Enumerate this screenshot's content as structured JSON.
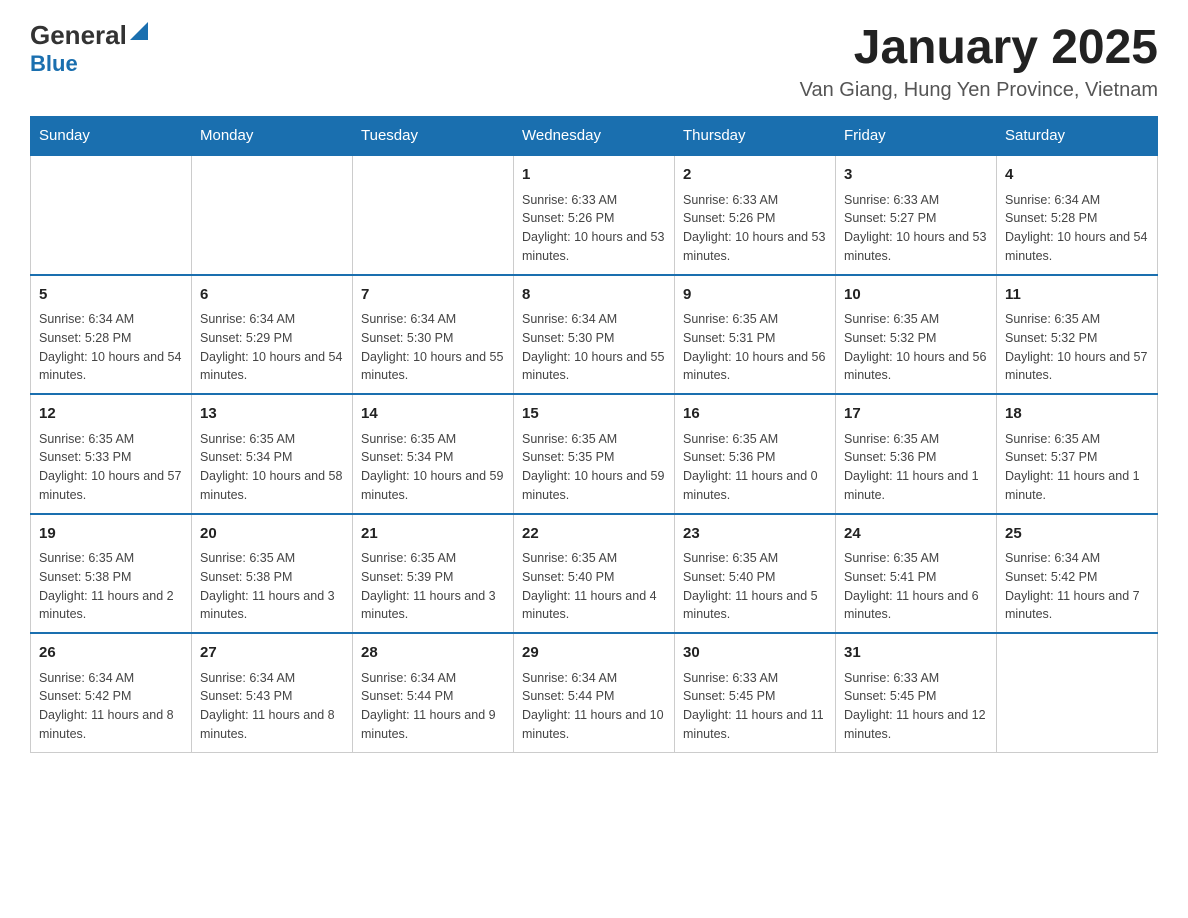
{
  "header": {
    "logo_general": "General",
    "logo_blue": "Blue",
    "title": "January 2025",
    "subtitle": "Van Giang, Hung Yen Province, Vietnam"
  },
  "days_of_week": [
    "Sunday",
    "Monday",
    "Tuesday",
    "Wednesday",
    "Thursday",
    "Friday",
    "Saturday"
  ],
  "weeks": [
    {
      "cells": [
        {
          "day": null
        },
        {
          "day": null
        },
        {
          "day": null
        },
        {
          "day": "1",
          "info": "Sunrise: 6:33 AM\nSunset: 5:26 PM\nDaylight: 10 hours and 53 minutes."
        },
        {
          "day": "2",
          "info": "Sunrise: 6:33 AM\nSunset: 5:26 PM\nDaylight: 10 hours and 53 minutes."
        },
        {
          "day": "3",
          "info": "Sunrise: 6:33 AM\nSunset: 5:27 PM\nDaylight: 10 hours and 53 minutes."
        },
        {
          "day": "4",
          "info": "Sunrise: 6:34 AM\nSunset: 5:28 PM\nDaylight: 10 hours and 54 minutes."
        }
      ]
    },
    {
      "cells": [
        {
          "day": "5",
          "info": "Sunrise: 6:34 AM\nSunset: 5:28 PM\nDaylight: 10 hours and 54 minutes."
        },
        {
          "day": "6",
          "info": "Sunrise: 6:34 AM\nSunset: 5:29 PM\nDaylight: 10 hours and 54 minutes."
        },
        {
          "day": "7",
          "info": "Sunrise: 6:34 AM\nSunset: 5:30 PM\nDaylight: 10 hours and 55 minutes."
        },
        {
          "day": "8",
          "info": "Sunrise: 6:34 AM\nSunset: 5:30 PM\nDaylight: 10 hours and 55 minutes."
        },
        {
          "day": "9",
          "info": "Sunrise: 6:35 AM\nSunset: 5:31 PM\nDaylight: 10 hours and 56 minutes."
        },
        {
          "day": "10",
          "info": "Sunrise: 6:35 AM\nSunset: 5:32 PM\nDaylight: 10 hours and 56 minutes."
        },
        {
          "day": "11",
          "info": "Sunrise: 6:35 AM\nSunset: 5:32 PM\nDaylight: 10 hours and 57 minutes."
        }
      ]
    },
    {
      "cells": [
        {
          "day": "12",
          "info": "Sunrise: 6:35 AM\nSunset: 5:33 PM\nDaylight: 10 hours and 57 minutes."
        },
        {
          "day": "13",
          "info": "Sunrise: 6:35 AM\nSunset: 5:34 PM\nDaylight: 10 hours and 58 minutes."
        },
        {
          "day": "14",
          "info": "Sunrise: 6:35 AM\nSunset: 5:34 PM\nDaylight: 10 hours and 59 minutes."
        },
        {
          "day": "15",
          "info": "Sunrise: 6:35 AM\nSunset: 5:35 PM\nDaylight: 10 hours and 59 minutes."
        },
        {
          "day": "16",
          "info": "Sunrise: 6:35 AM\nSunset: 5:36 PM\nDaylight: 11 hours and 0 minutes."
        },
        {
          "day": "17",
          "info": "Sunrise: 6:35 AM\nSunset: 5:36 PM\nDaylight: 11 hours and 1 minute."
        },
        {
          "day": "18",
          "info": "Sunrise: 6:35 AM\nSunset: 5:37 PM\nDaylight: 11 hours and 1 minute."
        }
      ]
    },
    {
      "cells": [
        {
          "day": "19",
          "info": "Sunrise: 6:35 AM\nSunset: 5:38 PM\nDaylight: 11 hours and 2 minutes."
        },
        {
          "day": "20",
          "info": "Sunrise: 6:35 AM\nSunset: 5:38 PM\nDaylight: 11 hours and 3 minutes."
        },
        {
          "day": "21",
          "info": "Sunrise: 6:35 AM\nSunset: 5:39 PM\nDaylight: 11 hours and 3 minutes."
        },
        {
          "day": "22",
          "info": "Sunrise: 6:35 AM\nSunset: 5:40 PM\nDaylight: 11 hours and 4 minutes."
        },
        {
          "day": "23",
          "info": "Sunrise: 6:35 AM\nSunset: 5:40 PM\nDaylight: 11 hours and 5 minutes."
        },
        {
          "day": "24",
          "info": "Sunrise: 6:35 AM\nSunset: 5:41 PM\nDaylight: 11 hours and 6 minutes."
        },
        {
          "day": "25",
          "info": "Sunrise: 6:34 AM\nSunset: 5:42 PM\nDaylight: 11 hours and 7 minutes."
        }
      ]
    },
    {
      "cells": [
        {
          "day": "26",
          "info": "Sunrise: 6:34 AM\nSunset: 5:42 PM\nDaylight: 11 hours and 8 minutes."
        },
        {
          "day": "27",
          "info": "Sunrise: 6:34 AM\nSunset: 5:43 PM\nDaylight: 11 hours and 8 minutes."
        },
        {
          "day": "28",
          "info": "Sunrise: 6:34 AM\nSunset: 5:44 PM\nDaylight: 11 hours and 9 minutes."
        },
        {
          "day": "29",
          "info": "Sunrise: 6:34 AM\nSunset: 5:44 PM\nDaylight: 11 hours and 10 minutes."
        },
        {
          "day": "30",
          "info": "Sunrise: 6:33 AM\nSunset: 5:45 PM\nDaylight: 11 hours and 11 minutes."
        },
        {
          "day": "31",
          "info": "Sunrise: 6:33 AM\nSunset: 5:45 PM\nDaylight: 11 hours and 12 minutes."
        },
        {
          "day": null
        }
      ]
    }
  ],
  "accent_color": "#1a6faf"
}
